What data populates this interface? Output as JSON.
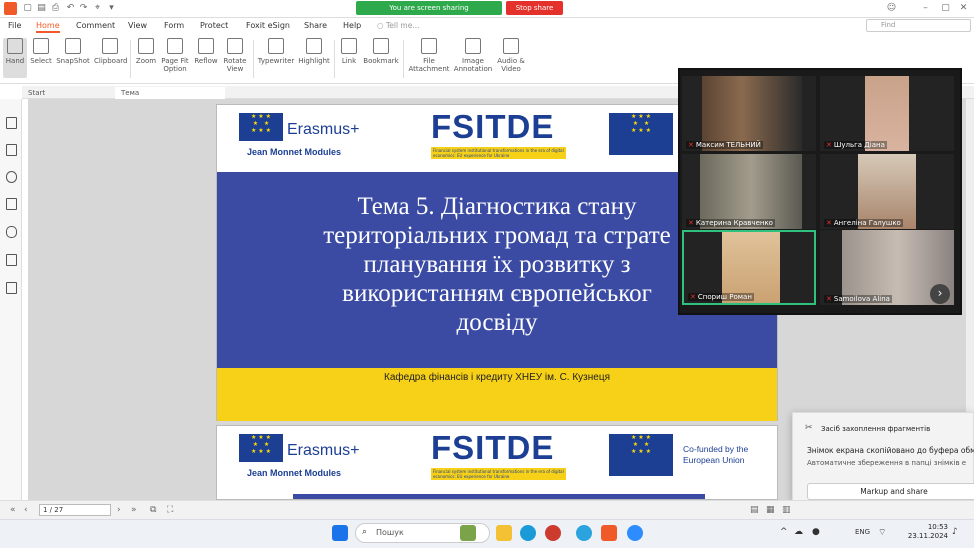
{
  "titlebar": {
    "share_status": "You are screen sharing",
    "stop_share": "Stop share"
  },
  "menu": {
    "items": [
      "File",
      "Home",
      "Comment",
      "View",
      "Form",
      "Protect",
      "Foxit eSign",
      "Share",
      "Help"
    ],
    "tell_me": "Tell me...",
    "find_placeholder": "Find"
  },
  "ribbon": {
    "tools": [
      {
        "label": "Hand",
        "icon": "hand-icon"
      },
      {
        "label": "Select",
        "icon": "select-icon"
      },
      {
        "label": "SnapShot",
        "icon": "snapshot-icon"
      },
      {
        "label": "Clipboard",
        "icon": "clipboard-icon"
      },
      {
        "label": "Zoom",
        "icon": "zoom-icon"
      },
      {
        "label": "Page Fit Option",
        "icon": "page-fit-icon"
      },
      {
        "label": "Reflow",
        "icon": "reflow-icon"
      },
      {
        "label": "Rotate View",
        "icon": "rotate-icon"
      },
      {
        "label": "Typewriter",
        "icon": "typewriter-icon"
      },
      {
        "label": "Highlight",
        "icon": "highlight-icon"
      },
      {
        "label": "Link",
        "icon": "link-icon"
      },
      {
        "label": "Bookmark",
        "icon": "bookmark-icon"
      },
      {
        "label": "File Attachment",
        "icon": "file-attachment-icon"
      },
      {
        "label": "Image Annotation",
        "icon": "image-annotation-icon"
      },
      {
        "label": "Audio & Video",
        "icon": "audio-video-icon"
      }
    ]
  },
  "tabs": [
    "Start",
    "Тема"
  ],
  "slide1": {
    "erasmus": "Erasmus+",
    "jean_monnet": "Jean Monnet Modules",
    "fsitde": "FSITDE",
    "fsitde_sub": "Financial system institutional transformations in the era of digital economics: EU experience for Ukraine",
    "title": "Тема 5. Діагностика стану\nтериторіальних громад та страте\nпланування їх розвитку з\nвикористанням європейськог\nдосвіду",
    "department": "Кафедра фінансів і кредиту ХНЕУ ім. С. Кузнеця"
  },
  "slide2": {
    "erasmus": "Erasmus+",
    "jean_monnet": "Jean Monnet Modules",
    "fsitde": "FSITDE",
    "fsitde_sub": "Financial system institutional transformations in the era of digital economics: EU experience for Ukraine",
    "cofunded": "Co-funded by the\nEuropean Union"
  },
  "status": {
    "page": "1 / 27"
  },
  "zoom": {
    "participants": [
      "Максим ТЕЛЬНИЙ",
      "Шульга Діана",
      "Катерина Кравченко",
      "Ангеліна Галушко",
      "Спориш Роман",
      "Samoilova Alina"
    ]
  },
  "notification": {
    "app": "Засіб захоплення фрагментів",
    "title": "Знімок екрана скопійовано до буфера обм",
    "text": "Автоматичне збереження в папці знімків е",
    "button": "Markup and share"
  },
  "taskbar": {
    "search_placeholder": "Пошук",
    "lang": "ENG",
    "time": "10:53",
    "date": "23.11.2024"
  },
  "colors": {
    "accent": "#f05a28",
    "share_green": "#2ea94c",
    "stop_red": "#e5312b",
    "slide_blue": "#3b4ba3",
    "slide_yellow": "#f7d117"
  }
}
